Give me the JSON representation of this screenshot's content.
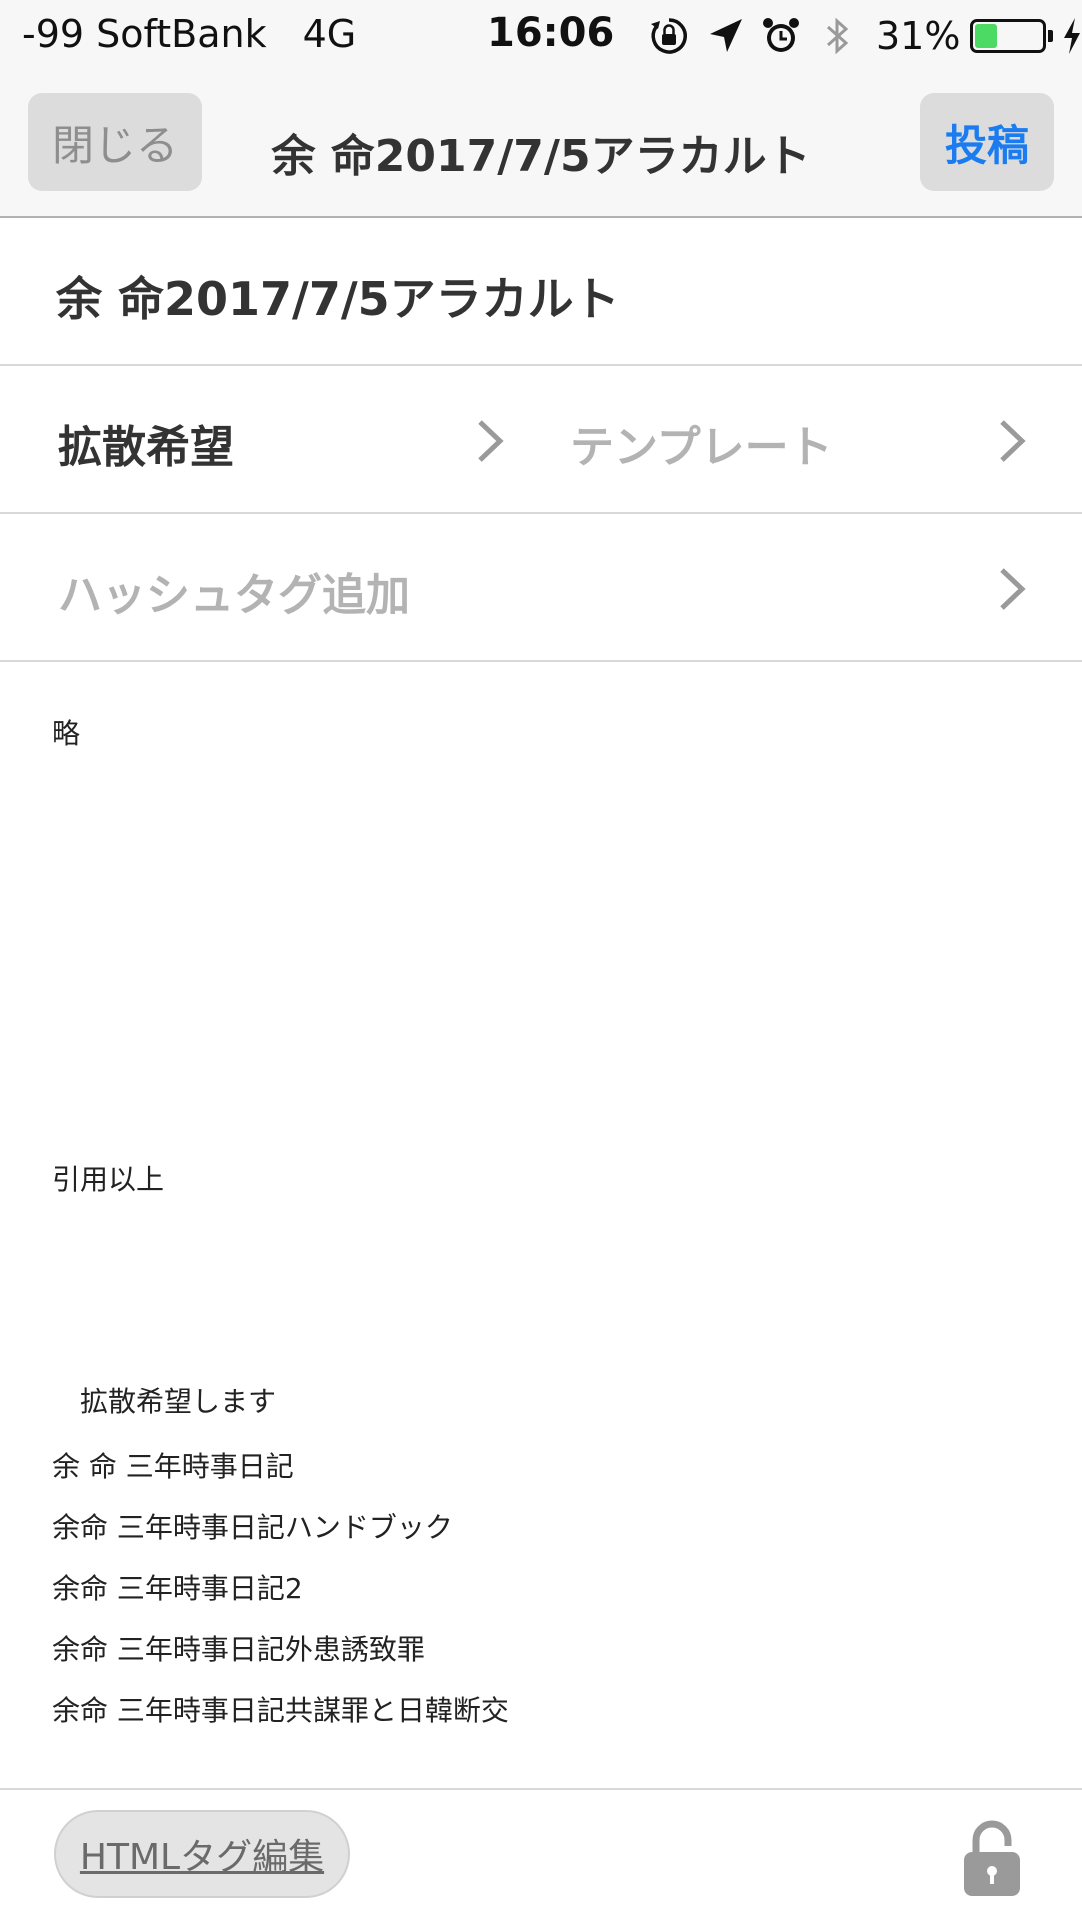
{
  "status_bar": {
    "carrier": "-99 SoftBank",
    "network": "4G",
    "time": "16:06",
    "icons": [
      "orientation-lock-icon",
      "location-arrow-icon",
      "alarm-icon",
      "bluetooth-icon"
    ],
    "battery_percent": "31%",
    "battery_level": 0.31,
    "battery_color": "#4cd964",
    "charging": true
  },
  "nav": {
    "close_label": "閉じる",
    "title": "余 命2017/7/5アラカルト",
    "post_label": "投稿",
    "post_color": "#1a7cf0"
  },
  "form": {
    "title_value": "余 命2017/7/5アラカルト",
    "diffusion_label": "拡散希望",
    "template_placeholder": "テンプレート",
    "hashtag_placeholder": "ハッシュタグ追加"
  },
  "body": {
    "lines": [
      "略",
      "引用以上",
      "　拡散希望します",
      "余 命 三年時事日記",
      "余命 三年時事日記ハンドブック",
      "余命 三年時事日記2",
      "余命 三年時事日記外患誘致罪",
      "余命 三年時事日記共謀罪と日韓断交"
    ]
  },
  "toolbar": {
    "html_edit_label": "HTMLタグ編集",
    "lock_icon": "lock-icon"
  }
}
